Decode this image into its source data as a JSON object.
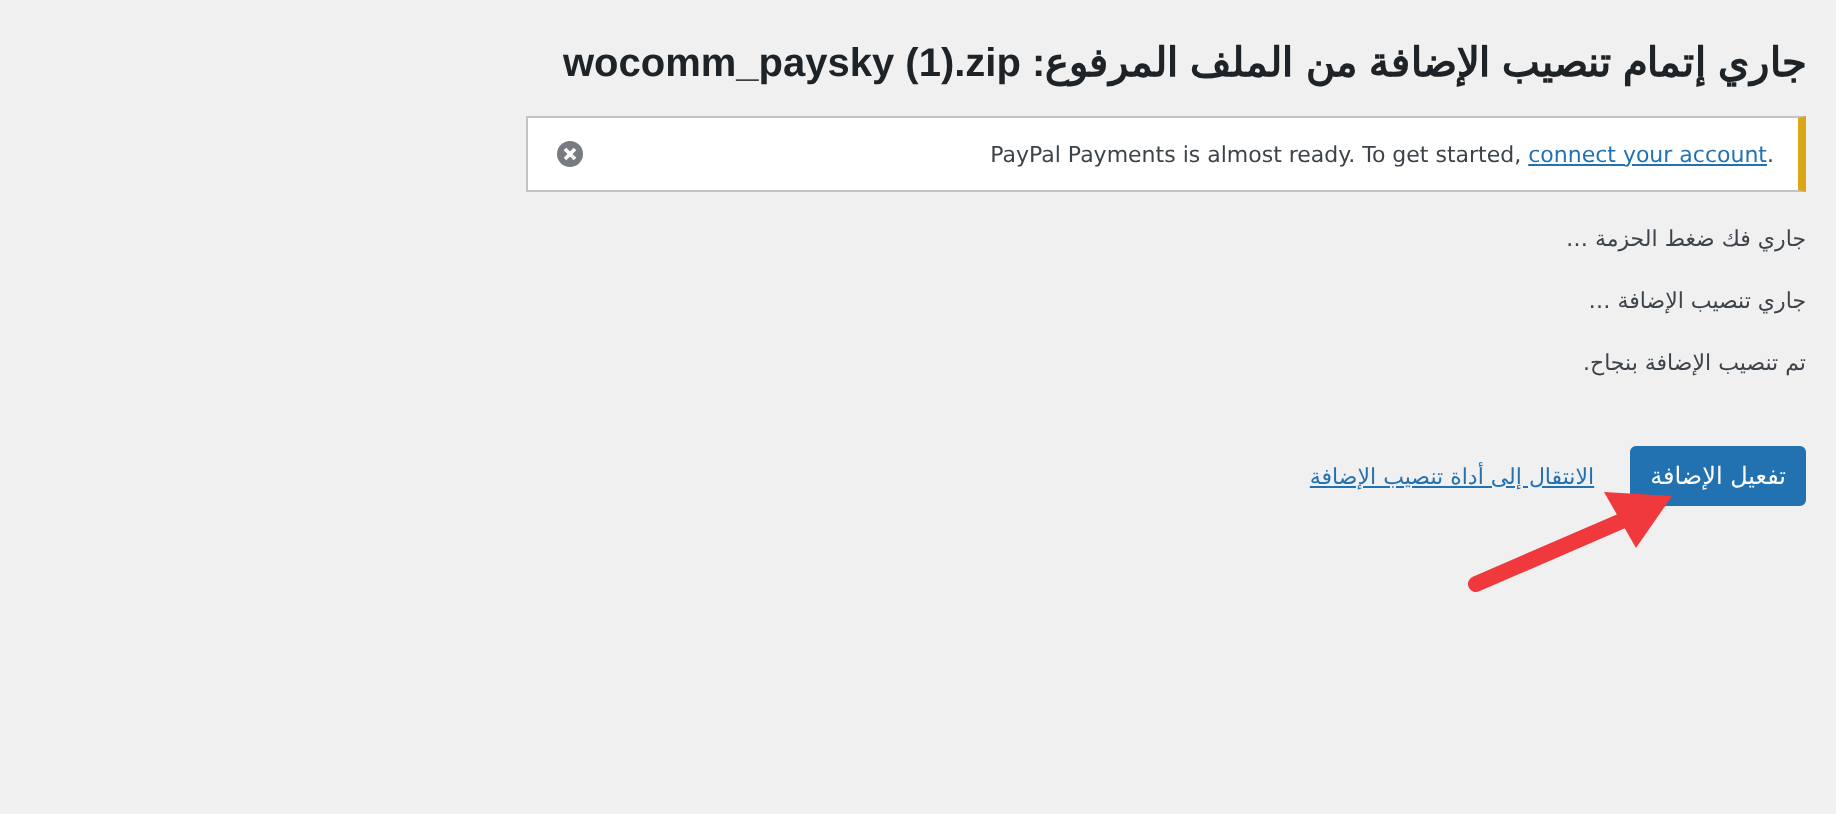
{
  "title": "جاري إتمام تنصيب الإضافة من الملف المرفوع: wocomm_paysky (1).zip",
  "notice": {
    "text": "PayPal Payments is almost ready. To get started, ",
    "link": "connect your account",
    "after": "."
  },
  "log": [
    "جاري فك ضغط الحزمة …",
    "جاري تنصيب الإضافة …",
    "تم تنصيب الإضافة بنجاح."
  ],
  "actions": [
    {
      "kind": "button",
      "label": "تفعيل الإضافة"
    },
    {
      "kind": "link",
      "label": "الانتقال إلى أداة تنصيب الإضافة"
    }
  ]
}
